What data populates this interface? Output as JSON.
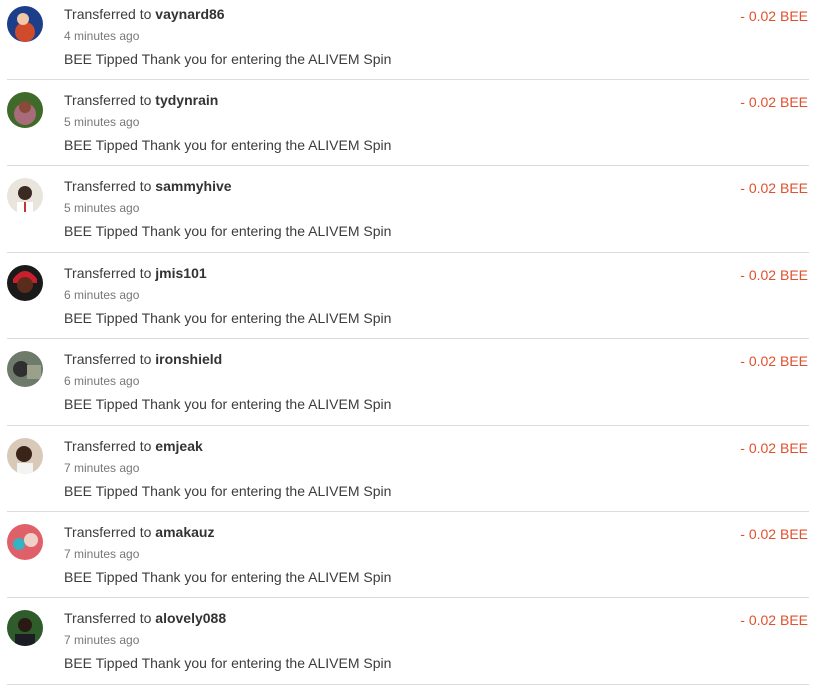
{
  "transfers": [
    {
      "prefix": "Transferred to",
      "user": "vaynard86",
      "time": "4 minutes ago",
      "memo": "BEE Tipped Thank you for entering the ALIVEM Spin",
      "amount": "- 0.02 BEE",
      "avatar_colors": [
        "#1d3f8a",
        "#d04a2c"
      ]
    },
    {
      "prefix": "Transferred to",
      "user": "tydynrain",
      "time": "5 minutes ago",
      "memo": "BEE Tipped Thank you for entering the ALIVEM Spin",
      "amount": "- 0.02 BEE",
      "avatar_colors": [
        "#3f6a2a",
        "#a86b7a"
      ]
    },
    {
      "prefix": "Transferred to",
      "user": "sammyhive",
      "time": "5 minutes ago",
      "memo": "BEE Tipped Thank you for entering the ALIVEM Spin",
      "amount": "- 0.02 BEE",
      "avatar_colors": [
        "#e9e4dc",
        "#3b2a22"
      ]
    },
    {
      "prefix": "Transferred to",
      "user": "jmis101",
      "time": "6 minutes ago",
      "memo": "BEE Tipped Thank you for entering the ALIVEM Spin",
      "amount": "- 0.02 BEE",
      "avatar_colors": [
        "#c8202e",
        "#5a2c1c"
      ]
    },
    {
      "prefix": "Transferred to",
      "user": "ironshield",
      "time": "6 minutes ago",
      "memo": "BEE Tipped Thank you for entering the ALIVEM Spin",
      "amount": "- 0.02 BEE",
      "avatar_colors": [
        "#6e7a6a",
        "#2f2f2f"
      ]
    },
    {
      "prefix": "Transferred to",
      "user": "emjeak",
      "time": "7 minutes ago",
      "memo": "BEE Tipped Thank you for entering the ALIVEM Spin",
      "amount": "- 0.02 BEE",
      "avatar_colors": [
        "#d9c9b8",
        "#3a2318"
      ]
    },
    {
      "prefix": "Transferred to",
      "user": "amakauz",
      "time": "7 minutes ago",
      "memo": "BEE Tipped Thank you for entering the ALIVEM Spin",
      "amount": "- 0.02 BEE",
      "avatar_colors": [
        "#e0606a",
        "#35b3c2"
      ]
    },
    {
      "prefix": "Transferred to",
      "user": "alovely088",
      "time": "7 minutes ago",
      "memo": "BEE Tipped Thank you for entering the ALIVEM Spin",
      "amount": "- 0.02 BEE",
      "avatar_colors": [
        "#2e5c2a",
        "#2a1a14"
      ]
    }
  ]
}
